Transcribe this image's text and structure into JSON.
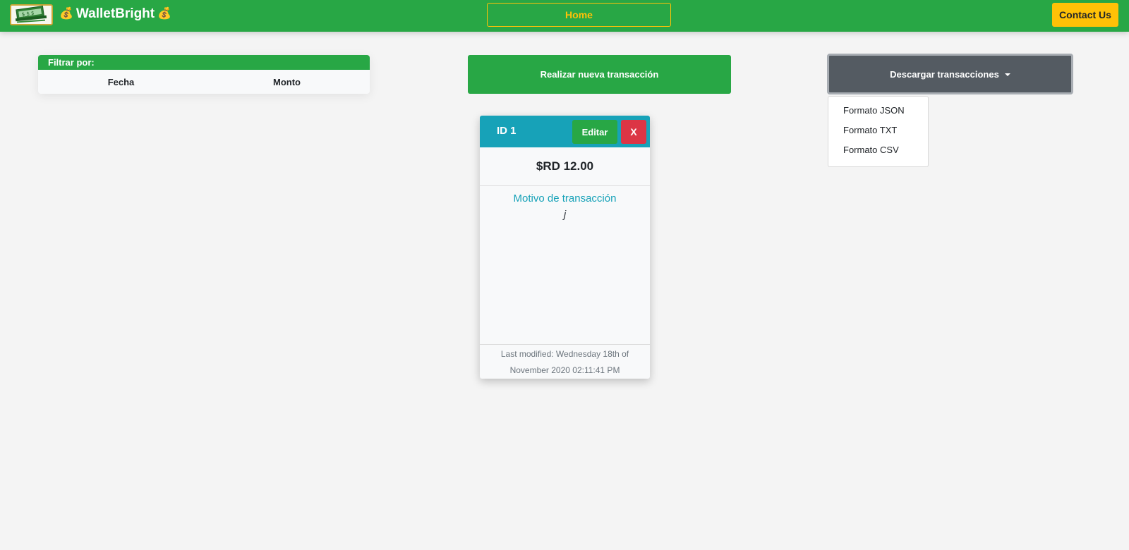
{
  "navbar": {
    "brand": "WalletBright",
    "brand_icon_left": "💰",
    "brand_icon_right": "💰",
    "home_label": "Home",
    "contact_label": "Contact Us"
  },
  "filter": {
    "title": "Filtrar por:",
    "options": [
      "Fecha",
      "Monto"
    ]
  },
  "actions": {
    "new_transaction_label": "Realizar nueva transacción",
    "download_label": "Descargar transacciones",
    "download_menu": [
      "Formato JSON",
      "Formato TXT",
      "Formato CSV"
    ]
  },
  "transaction": {
    "id_label": "ID 1",
    "edit_label": "Editar",
    "delete_label": "X",
    "amount": "$RD 12.00",
    "reason_label": "Motivo de transacción",
    "reason_value": "j",
    "last_modified": "Last modified: Wednesday 18th of November 2020 02:11:41 PM"
  },
  "colors": {
    "primary_green": "#28a745",
    "warning_yellow": "#ffc107",
    "info_teal": "#17a2b8",
    "danger_red": "#dc3545",
    "secondary_gray": "#545b62",
    "page_background": "#f4f4f4"
  },
  "icons": {
    "logo": "money-banknotes-icon",
    "brand_emoji": "money-bag-icon",
    "dropdown_caret": "caret-down-icon"
  }
}
